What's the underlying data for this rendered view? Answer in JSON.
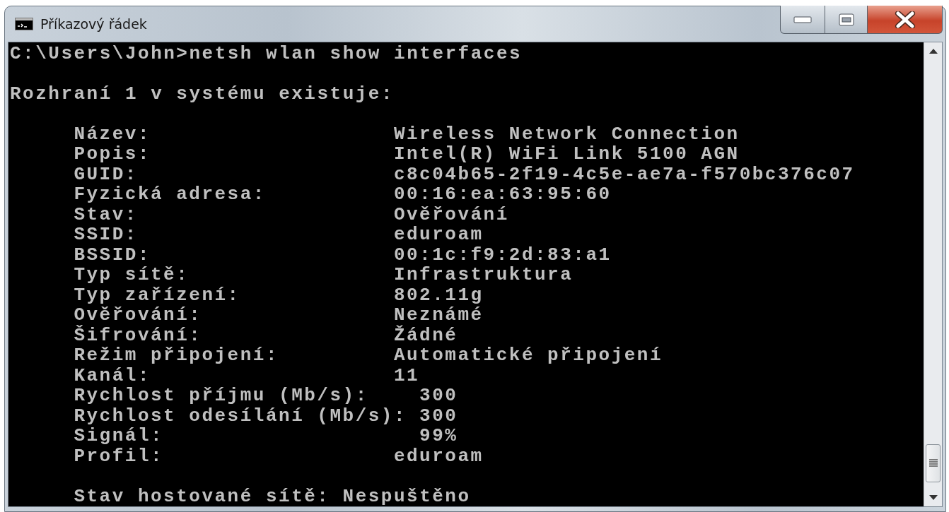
{
  "window": {
    "title": "Příkazový řádek"
  },
  "console": {
    "command_line": "C:\\Users\\John>netsh wlan show interfaces",
    "header": "Rozhraní 1 v systému existuje:",
    "fields": [
      {
        "kind": "text",
        "label": "Název:",
        "value": "Wireless Network Connection"
      },
      {
        "kind": "text",
        "label": "Popis:",
        "value": "Intel(R) WiFi Link 5100 AGN"
      },
      {
        "kind": "text",
        "label": "GUID:",
        "value": "c8c04b65-2f19-4c5e-ae7a-f570bc376c07"
      },
      {
        "kind": "text",
        "label": "Fyzická adresa:",
        "value": "00:16:ea:63:95:60"
      },
      {
        "kind": "text",
        "label": "Stav:",
        "value": "Ověřování"
      },
      {
        "kind": "text",
        "label": "SSID:",
        "value": "eduroam"
      },
      {
        "kind": "text",
        "label": "BSSID:",
        "value": "00:1c:f9:2d:83:a1"
      },
      {
        "kind": "text",
        "label": "Typ sítě:",
        "value": "Infrastruktura"
      },
      {
        "kind": "text",
        "label": "Typ zařízení:",
        "value": "802.11g"
      },
      {
        "kind": "text",
        "label": "Ověřování:",
        "value": "Neznámé"
      },
      {
        "kind": "text",
        "label": "Šifrování:",
        "value": "Žádné"
      },
      {
        "kind": "text",
        "label": "Režim připojení:",
        "value": "Automatické připojení"
      },
      {
        "kind": "text",
        "label": "Kanál:",
        "value": "11"
      },
      {
        "kind": "number",
        "label": "Rychlost příjmu (Mb/s):",
        "value": "300"
      },
      {
        "kind": "number",
        "label": "Rychlost odesílání (Mb/s):",
        "value": "300"
      },
      {
        "kind": "number",
        "label": "Signál:",
        "value": "99%"
      },
      {
        "kind": "text",
        "label": "Profil:",
        "value": "eduroam"
      }
    ],
    "footer": "Stav hostované sítě: Nespuštěno"
  }
}
